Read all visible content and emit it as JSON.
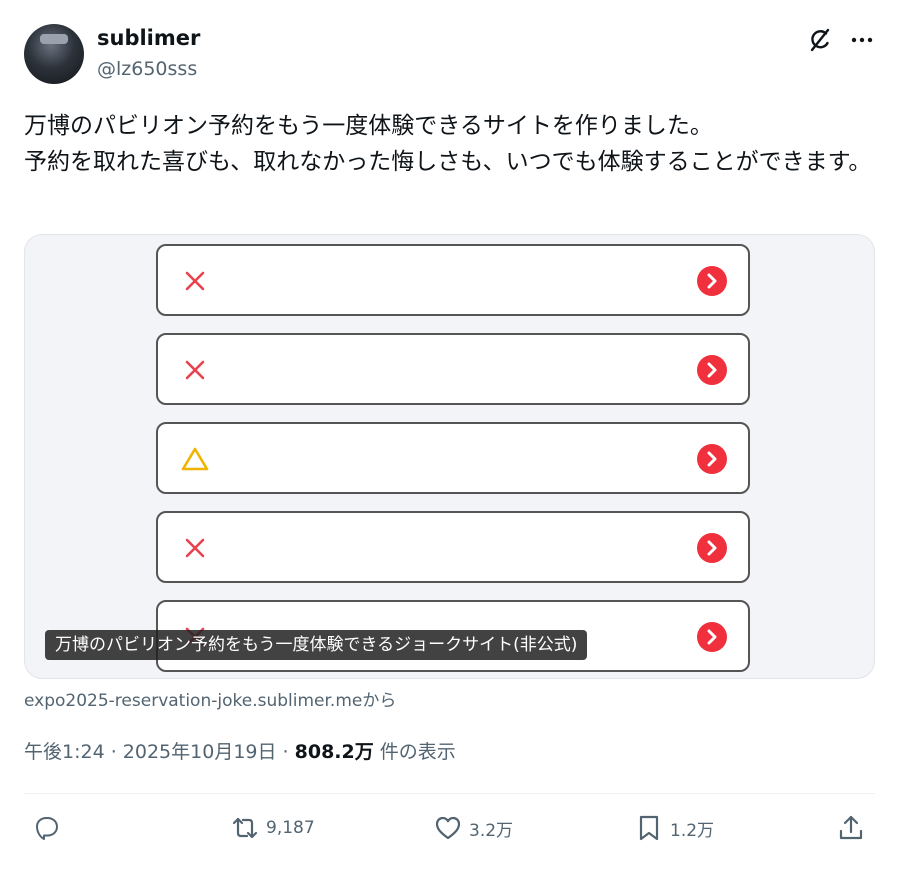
{
  "author": {
    "name": "sublimer",
    "handle": "@lz650sss"
  },
  "tweet": {
    "text": "万博のパビリオン予約をもう一度体験できるサイトを作りました。\n予約を取れた喜びも、取れなかった悔しさも、いつでも体験することができます。"
  },
  "card": {
    "caption": "万博のパビリオン予約をもう一度体験できるジョークサイト(非公式)",
    "rows": [
      {
        "status": "cross-icon"
      },
      {
        "status": "cross-icon"
      },
      {
        "status": "triangle-icon"
      },
      {
        "status": "cross-icon"
      },
      {
        "status": "cross-icon"
      }
    ],
    "source": "expo2025-reservation-joke.sublimer.meから"
  },
  "meta": {
    "time": "午後1:24 · 2025年10月19日 · ",
    "views": "808.2万",
    "views_suffix": " 件の表示"
  },
  "actions": {
    "reply": {
      "icon": "reply-icon",
      "count": ""
    },
    "retweet": {
      "icon": "retweet-icon",
      "count": "9,187"
    },
    "like": {
      "icon": "heart-icon",
      "count": "3.2万"
    },
    "bookmark": {
      "icon": "bookmark-icon",
      "count": "1.2万"
    },
    "share": {
      "icon": "share-icon",
      "count": ""
    }
  },
  "colors": {
    "cross": "#e8424f",
    "triangle": "#f0b400",
    "go_button": "#f0303c"
  }
}
